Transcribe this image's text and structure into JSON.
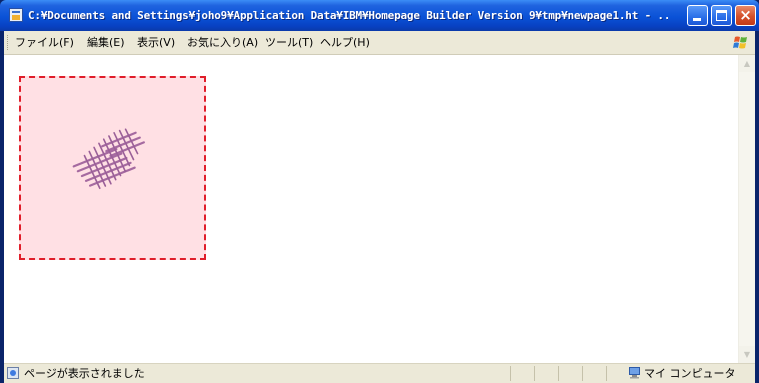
{
  "window": {
    "title": "C:¥Documents and Settings¥joho9¥Application Data¥IBM¥Homepage Builder Version 9¥tmp¥newpage1.ht - ...",
    "minimize_icon": "minimize-icon",
    "maximize_icon": "maximize-icon",
    "close_icon": "close-icon",
    "close_glyph": "×"
  },
  "menubar": {
    "items": [
      {
        "label": "ファイル(F)"
      },
      {
        "label": "編集(E)"
      },
      {
        "label": "表示(V)"
      },
      {
        "label": "お気に入り(A)"
      },
      {
        "label": "ツール(T)"
      },
      {
        "label": "ヘルプ(H)"
      }
    ],
    "logo_icon": "windows-logo-icon"
  },
  "content": {
    "image": {
      "icon": "book-pages-icon",
      "border_color": "#e01e2a",
      "background_color": "#ffe0e4"
    }
  },
  "statusbar": {
    "icon": "ie-page-icon",
    "text": "ページが表示されました",
    "zone_icon": "my-computer-icon",
    "zone_text": "マイ コンピュータ"
  },
  "colors": {
    "titlebar": "#0a52d7",
    "chrome": "#ece9d8",
    "close_button": "#d4502a"
  }
}
